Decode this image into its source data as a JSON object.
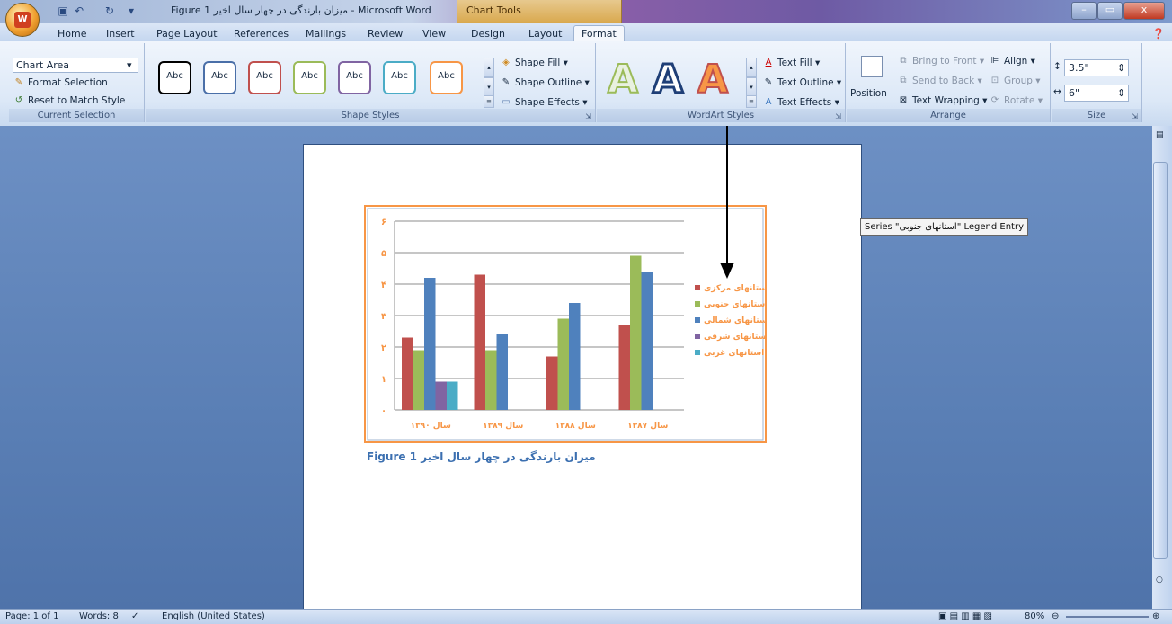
{
  "window": {
    "title_doc": "Figure 1 میزان بارندگی در چهار سال اخیر",
    "title_app": " - Microsoft Word",
    "context_tab": "Chart Tools",
    "buttons": {
      "min": "–",
      "max": "▭",
      "close": "x"
    }
  },
  "office_button": {
    "label": "W"
  },
  "tabs": [
    "Home",
    "Insert",
    "Page Layout",
    "References",
    "Mailings",
    "Review",
    "View",
    "Design",
    "Layout",
    "Format"
  ],
  "active_tab": "Format",
  "ribbon": {
    "current_selection": {
      "dropdown_value": "Chart Area",
      "format_selection": "Format Selection",
      "reset": "Reset to Match Style",
      "label": "Current Selection"
    },
    "shape_styles": {
      "swatches": [
        {
          "label": "Abc",
          "color": "#000000"
        },
        {
          "label": "Abc",
          "color": "#4a6fa8"
        },
        {
          "label": "Abc",
          "color": "#c0504d"
        },
        {
          "label": "Abc",
          "color": "#9bbb59"
        },
        {
          "label": "Abc",
          "color": "#8064a2"
        },
        {
          "label": "Abc",
          "color": "#4bacc6"
        },
        {
          "label": "Abc",
          "color": "#f79646"
        }
      ],
      "shape_fill": "Shape Fill ▾",
      "shape_outline": "Shape Outline ▾",
      "shape_effects": "Shape Effects ▾",
      "label": "Shape Styles"
    },
    "wordart_styles": {
      "letters": [
        "A",
        "A",
        "A"
      ],
      "text_fill": "Text Fill ▾",
      "text_outline": "Text Outline ▾",
      "text_effects": "Text Effects ▾",
      "label": "WordArt Styles"
    },
    "arrange": {
      "position": "Position",
      "bring_to_front": "Bring to Front ▾",
      "send_to_back": "Send to Back ▾",
      "text_wrapping": "Text Wrapping ▾",
      "align": "Align ▾",
      "group": "Group ▾",
      "rotate": "Rotate ▾",
      "label": "Arrange"
    },
    "size": {
      "height": "3.5\"",
      "width": "6\"",
      "label": "Size"
    }
  },
  "document": {
    "caption": "Figure 1  میزان بارندگی در چهار سال اخیر",
    "tooltip": "Series \"استانهای جنوبی\" Legend Entry"
  },
  "status": {
    "page": "Page: 1 of 1",
    "words": "Words: 8",
    "language": "English (United States)",
    "zoom": "80%"
  },
  "chart_data": {
    "type": "bar",
    "categories": [
      "سال ۱۳۹۰",
      "سال ۱۳۸۹",
      "سال ۱۳۸۸",
      "سال ۱۳۸۷"
    ],
    "series": [
      {
        "name": "استانهای مرکزی",
        "values": [
          2.3,
          4.3,
          1.7,
          2.7
        ],
        "color": "#c0504d"
      },
      {
        "name": "استانهای جنوبی",
        "values": [
          1.9,
          1.9,
          2.9,
          4.9
        ],
        "color": "#9bbb59"
      },
      {
        "name": "استانهای شمالی",
        "values": [
          4.2,
          2.4,
          3.4,
          4.4
        ],
        "color": "#4f81bd"
      },
      {
        "name": "استانهای شرقی",
        "values": [
          0.9,
          0,
          0,
          0
        ],
        "color": "#8064a2"
      },
      {
        "name": "استانهای غربی",
        "values": [
          0.9,
          0,
          0,
          0
        ],
        "color": "#4bacc6"
      }
    ],
    "ylim": [
      0,
      6
    ],
    "yticks": [
      "۰",
      "۱",
      "۲",
      "۳",
      "۴",
      "۵",
      "۶"
    ],
    "gridlines": true,
    "legend_position": "right"
  }
}
